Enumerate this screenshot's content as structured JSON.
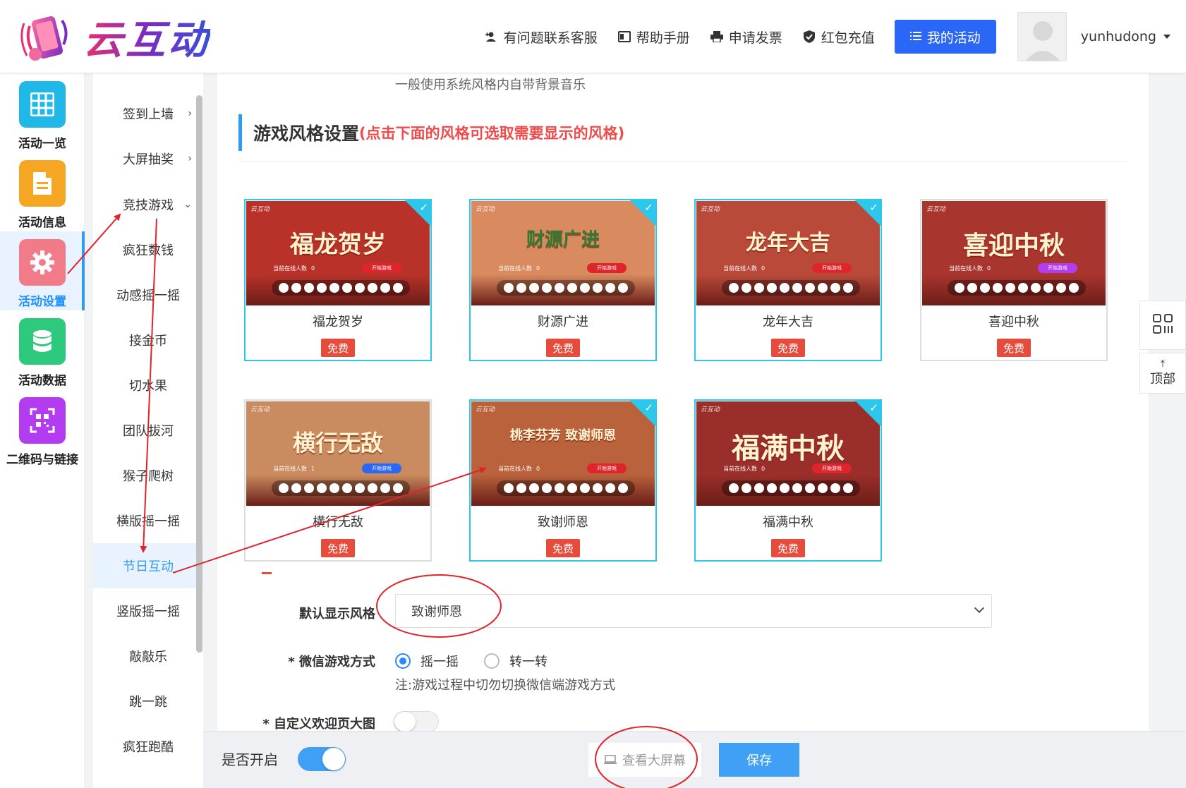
{
  "header": {
    "logo_text": "云互动",
    "nav": [
      {
        "label": "有问题联系客服",
        "icon": "user-plus-icon"
      },
      {
        "label": "帮助手册",
        "icon": "book-icon"
      },
      {
        "label": "申请发票",
        "icon": "printer-icon"
      },
      {
        "label": "红包充值",
        "icon": "shield-check-icon"
      }
    ],
    "my_activity_label": "我的活动",
    "username": "yunhudong"
  },
  "rail": [
    {
      "label": "活动一览",
      "icon": "grid-icon",
      "color": "#1fb8e8"
    },
    {
      "label": "活动信息",
      "icon": "document-icon",
      "color": "#f5a623"
    },
    {
      "label": "活动设置",
      "icon": "gear-icon",
      "color": "#f27b8a",
      "active": true
    },
    {
      "label": "活动数据",
      "icon": "database-icon",
      "color": "#2dc97d"
    },
    {
      "label": "二维码与链接",
      "icon": "qrcode-icon",
      "color": "#b43cf0"
    }
  ],
  "submenu": [
    {
      "label": "签到上墙",
      "chevron": "›"
    },
    {
      "label": "大屏抽奖",
      "chevron": "›"
    },
    {
      "label": "竞技游戏",
      "chevron": "⌄"
    },
    {
      "label": "疯狂数钱"
    },
    {
      "label": "动感摇一摇"
    },
    {
      "label": "接金币"
    },
    {
      "label": "切水果"
    },
    {
      "label": "团队拔河"
    },
    {
      "label": "猴子爬树"
    },
    {
      "label": "横版摇一摇"
    },
    {
      "label": "节日互动",
      "active": true
    },
    {
      "label": "竖版摇一摇"
    },
    {
      "label": "敲敲乐"
    },
    {
      "label": "跳一跳"
    },
    {
      "label": "疯狂跑酷"
    }
  ],
  "main": {
    "music_note": "一般使用系统风格内自带背景音乐",
    "section_title": "游戏风格设置",
    "section_hint": "(点击下面的风格可选取需要显示的风格)",
    "cards": [
      {
        "name": "福龙贺岁",
        "badge": "免费",
        "selected": true,
        "thumb_title": "福龙贺岁",
        "bg": "#b8322a"
      },
      {
        "name": "财源广进",
        "badge": "免费",
        "selected": true,
        "thumb_title": "财源广进",
        "bg": "#d98a5e"
      },
      {
        "name": "龙年大吉",
        "badge": "免费",
        "selected": true,
        "thumb_title": "龙年大吉",
        "bg": "#b94a3a"
      },
      {
        "name": "喜迎中秋",
        "badge": "免费",
        "selected": false,
        "thumb_title": "喜迎中秋",
        "bg": "#a9352f"
      },
      {
        "name": "横行无敌",
        "badge": "免费",
        "selected": false,
        "thumb_title": "横行无敌",
        "bg": "#c98b5f"
      },
      {
        "name": "致谢师恩",
        "badge": "免费",
        "selected": true,
        "thumb_title": "桃李芬芳 致谢师恩",
        "bg": "#b9623c"
      },
      {
        "name": "福满中秋",
        "badge": "免费",
        "selected": true,
        "thumb_title": "福满中秋",
        "bg": "#9a2e2a"
      }
    ],
    "thumb_watermark": "云互动",
    "thumb_count_label": "当前在线人数",
    "thumb_start_label": "开始游戏",
    "thumb_count_values": [
      "0",
      "0",
      "0",
      "0",
      "1",
      "0",
      "0"
    ],
    "default_style_label": "默认显示风格",
    "default_style_value": "致谢师恩",
    "wechat_mode_label": "* 微信游戏方式",
    "wechat_modes": [
      "摇一摇",
      "转一转"
    ],
    "wechat_mode_selected": "摇一摇",
    "wechat_mode_hint": "注:游戏过程中切勿切换微信端游戏方式",
    "custom_welcome_label": "* 自定义欢迎页大图"
  },
  "bottom": {
    "enable_label": "是否开启",
    "view_screen_label": "查看大屏幕",
    "save_label": "保存"
  },
  "float_buttons": {
    "qrcode_icon": "qrcode-icon",
    "top_label": "顶部"
  },
  "accent_colors": {
    "primary": "#2b67f6",
    "active_blue": "#2e9bf0",
    "selected_border": "#2ec7ec",
    "badge_red": "#e64b3c",
    "annotation_red": "#e0242b"
  }
}
